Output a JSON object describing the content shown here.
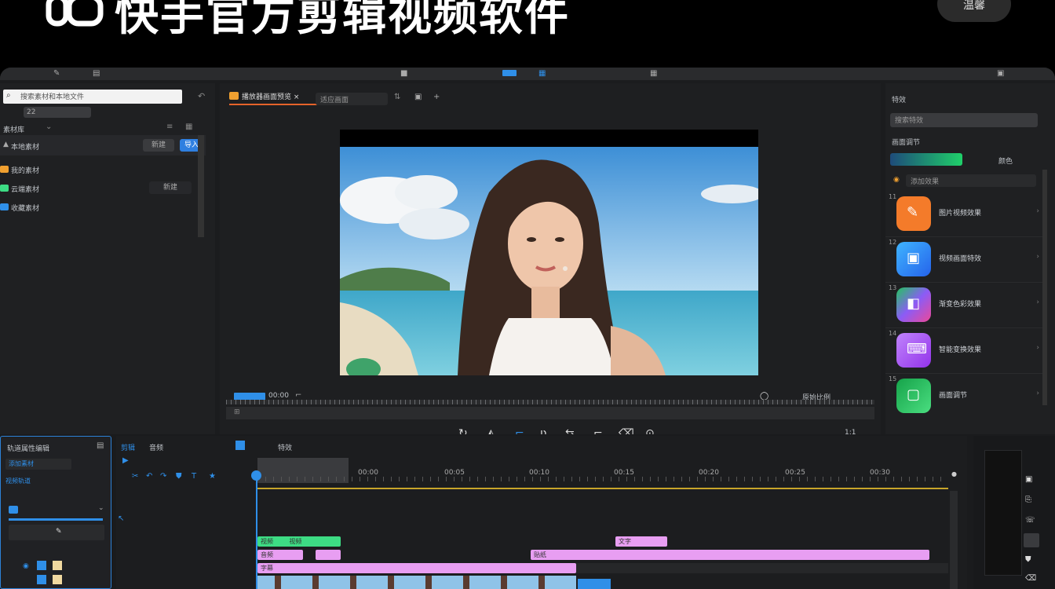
{
  "header": {
    "title": "快手官方剪辑视频软件",
    "button_label": "温馨"
  },
  "left_panel": {
    "search_placeholder": "搜索素材和本地文件",
    "dropdown": "22",
    "section_label": "素材库",
    "toolbar_btn": "导入",
    "rows": [
      {
        "label": "本地素材",
        "color": "#aaa"
      },
      {
        "label": "我的素材",
        "color": "#f0a030"
      },
      {
        "label": "云端素材",
        "color": "#3ddc84"
      },
      {
        "label": "收藏素材",
        "color": "#2f8fe8"
      }
    ],
    "row_btn": "新建"
  },
  "viewer": {
    "tab_label": "播放器画面预览",
    "tab_close": "×",
    "dropdown": "适应画面",
    "timecode": "00:00",
    "right_info": "原始比例",
    "footer_right": "1:1"
  },
  "right_panel": {
    "header": "特效",
    "search_placeholder": "搜索特效",
    "section_label": "画面调节",
    "grad_label": "颜色",
    "field_placeholder": "添加效果",
    "items": [
      {
        "num": "11",
        "label": "图片视频效果",
        "color": "#f47b2a",
        "glyph": "✎"
      },
      {
        "num": "12",
        "label": "视频画面特效",
        "color": "#2f8fe8",
        "glyph": "▣"
      },
      {
        "num": "13",
        "label": "渐变色彩效果",
        "color": "#8b5cf6",
        "glyph": "◧"
      },
      {
        "num": "14",
        "label": "智能变换效果",
        "color": "#a855f7",
        "glyph": "⌨"
      },
      {
        "num": "15",
        "label": "画面调节",
        "color": "#22c55e",
        "glyph": "▢"
      }
    ]
  },
  "bottom_panel": {
    "header": "轨道属性编辑",
    "field": "添加素材",
    "sub_label": "视频轨道",
    "tab_a": "剪辑",
    "tab_b": "音频",
    "tab_c": "特效",
    "ruler_labels": [
      "00:00",
      "00:05",
      "00:10",
      "00:15",
      "00:20",
      "00:25",
      "00:30"
    ]
  },
  "timeline": {
    "clips_green": [
      "视频",
      "视频"
    ],
    "clips_pink_top": [
      "文字"
    ],
    "clip_mid_labels": [
      "音频",
      "贴纸",
      "字幕"
    ]
  }
}
